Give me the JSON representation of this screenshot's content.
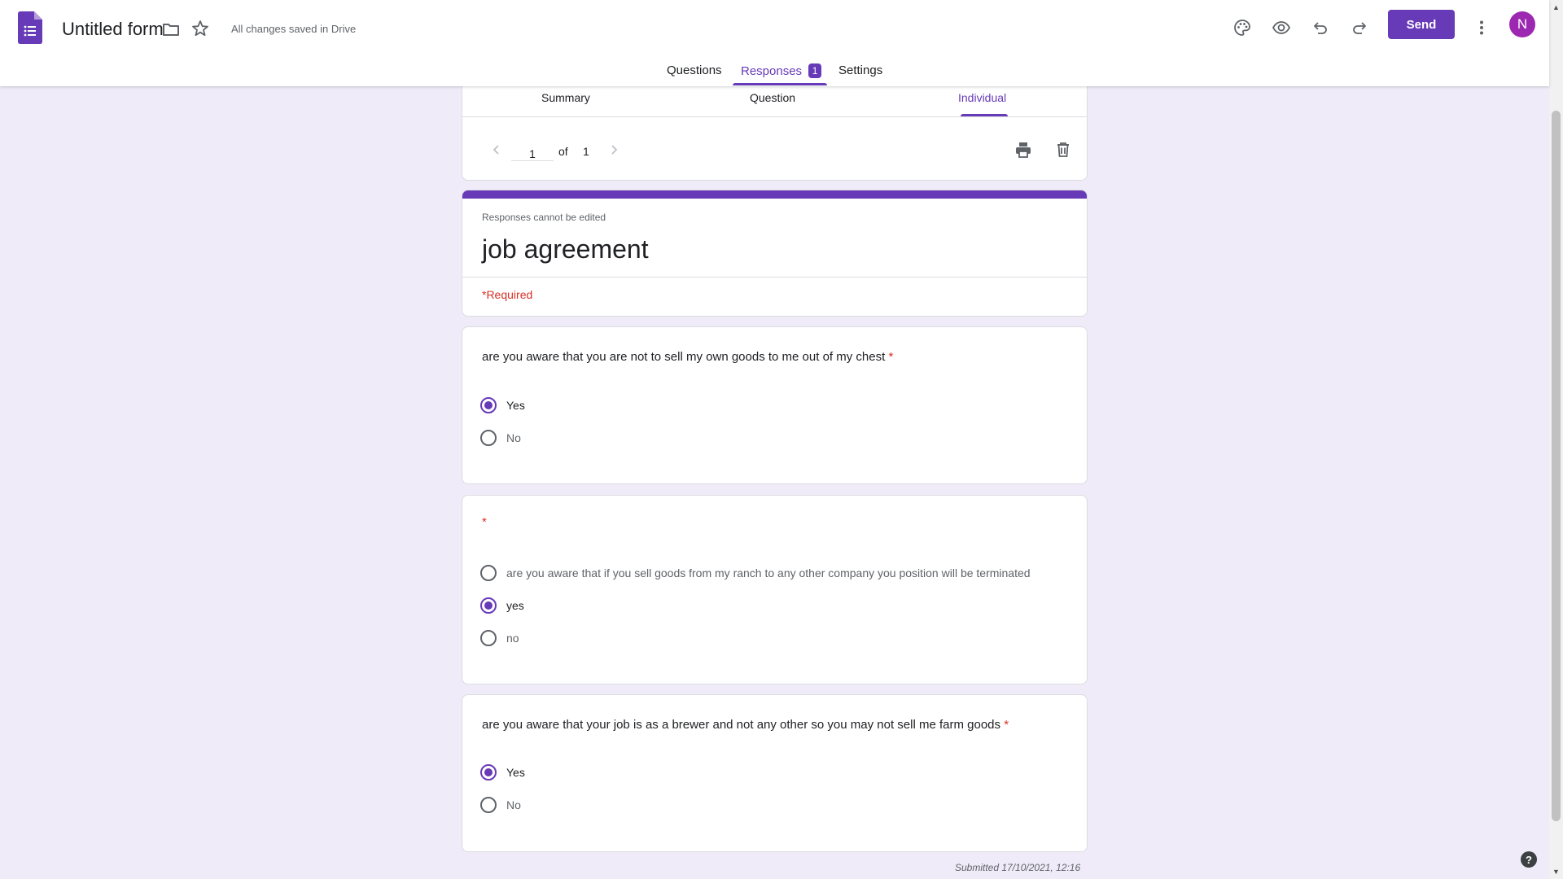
{
  "header": {
    "form_title": "Untitled form",
    "save_status": "All changes saved in Drive",
    "send_label": "Send",
    "avatar_initial": "N",
    "icons": [
      "forms-logo-icon",
      "folder-icon",
      "star-icon",
      "palette-icon",
      "eye-icon",
      "undo-icon",
      "redo-icon",
      "more-vert-icon"
    ]
  },
  "main_tabs": {
    "questions": "Questions",
    "responses": "Responses",
    "responses_count": "1",
    "settings": "Settings"
  },
  "sub_tabs": {
    "summary": "Summary",
    "question": "Question",
    "individual": "Individual"
  },
  "pager": {
    "current": "1",
    "of_label": "of",
    "total": "1"
  },
  "form": {
    "edit_note": "Responses cannot be edited",
    "heading": "job agreement",
    "required_note": "*Required"
  },
  "questions": [
    {
      "title": "are you aware that you are not to sell my own goods to me out of my chest",
      "required_mark": "*",
      "options": [
        {
          "label": "Yes",
          "checked": true
        },
        {
          "label": "No",
          "checked": false
        }
      ]
    },
    {
      "title": "",
      "required_mark": "*",
      "options": [
        {
          "label": "are you aware that if you sell goods from my ranch to any other company you position will be terminated",
          "checked": false
        },
        {
          "label": "yes",
          "checked": true
        },
        {
          "label": "no",
          "checked": false
        }
      ]
    },
    {
      "title": "are you aware that your job is as a brewer and not any other so you may not sell me farm goods",
      "required_mark": "*",
      "options": [
        {
          "label": "Yes",
          "checked": true
        },
        {
          "label": "No",
          "checked": false
        }
      ]
    }
  ],
  "footer": {
    "submitted": "Submitted 17/10/2021, 12:16",
    "help_label": "?"
  },
  "colors": {
    "accent": "#673ab7",
    "background": "#f0ebf8",
    "required": "#d93025",
    "avatar": "#9c27b0"
  }
}
